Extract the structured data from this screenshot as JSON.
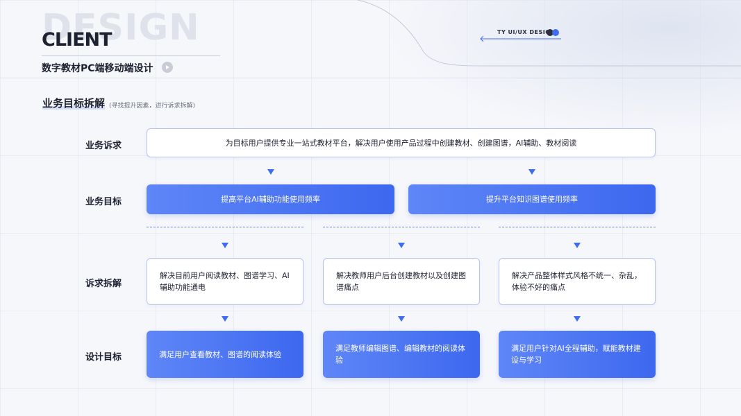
{
  "header": {
    "watermark": "DESIGN",
    "client": "CLIENT",
    "subtitle": "数字教材PC端移动端设计",
    "brand": "TY UI/UX DESIGN"
  },
  "section": {
    "title": "业务目标拆解",
    "note": "(寻找提升因素，进行诉求拆解)"
  },
  "rows": {
    "demand_label": "业务诉求",
    "goal_label": "业务目标",
    "breakdown_label": "诉求拆解",
    "design_label": "设计目标"
  },
  "demand": "为目标用户提供专业一站式教材平台，解决用户使用产品过程中创建教材、创建图谱，AI辅助、教材阅读",
  "goals": [
    "提高平台AI辅助功能使用频率",
    "提升平台知识图谱使用频率"
  ],
  "breakdowns": [
    "解决目前用户阅读教材、图谱学习、AI辅助功能通电",
    "解决教师用户后台创建教材以及创建图谱痛点",
    "解决产品整体样式风格不统一、杂乱，体验不好的痛点"
  ],
  "design_goals": [
    "满足用户查看教材、图谱的阅读体验",
    "满足教师编辑图谱、编辑教材的阅读体验",
    "满足用户针对AI全程辅助，赋能教材建设与学习"
  ],
  "colors": {
    "accent": "#3f6df2",
    "accent_light": "#5f86f7",
    "border_light": "#b4c3f4",
    "text": "#1e2230"
  },
  "icons": [
    "play-icon",
    "arrow-left-icon",
    "triangle-down-icon"
  ]
}
